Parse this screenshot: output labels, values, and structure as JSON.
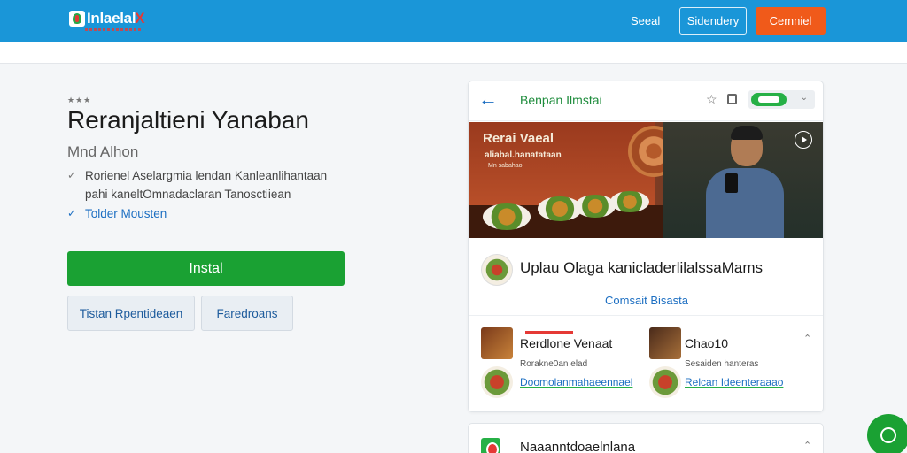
{
  "header": {
    "logo_text": "Inlaelal",
    "logo_x": "X",
    "nav_link": "Seeal",
    "nav_outline": "Sidendery",
    "nav_cta": "Cemniel"
  },
  "left": {
    "stars": "★★★",
    "title": "Reranjaltieni Yanaban",
    "subtitle": "Mnd Alhon",
    "features": [
      {
        "line1": "Rorienel Aselargmia lendan Kanleanlihantaan",
        "line2": "pahi kaneltOmnadaclaran Tanosctiiean"
      },
      {
        "line1": "Tolder Mousten"
      }
    ],
    "install_label": "Instal",
    "buttons": [
      "Tistan Rpentideaen",
      "Faredroans"
    ]
  },
  "card": {
    "title": "Benpan Ilmstai",
    "hero": {
      "line1": "Rerai Vaeal",
      "line2": "aliabal.hanatataan",
      "line3": "Mn sabahao"
    },
    "description": "Uplau Olaga kanicladerlilalssaMams",
    "center_link": "Comsait Bisasta",
    "items": [
      {
        "name": "Rerdlone Venaat",
        "meta": "Rorakne0an elad",
        "link": "Doomolanmahaeennael"
      },
      {
        "name": "Chao10",
        "meta": "Sesaiden hanteras",
        "link": "Relcan Ideenteraaao"
      }
    ]
  },
  "card2": {
    "text": "Naaanntdoaelnlana"
  },
  "colors": {
    "topbar": "#1a96d8",
    "cta": "#f05a1a",
    "install": "#1aa133",
    "link": "#1d6fc2"
  },
  "icons": [
    "back-arrow-icon",
    "star-icon",
    "square-icon",
    "toggle-icon",
    "play-icon",
    "chevron-up-icon",
    "chat-icon"
  ]
}
